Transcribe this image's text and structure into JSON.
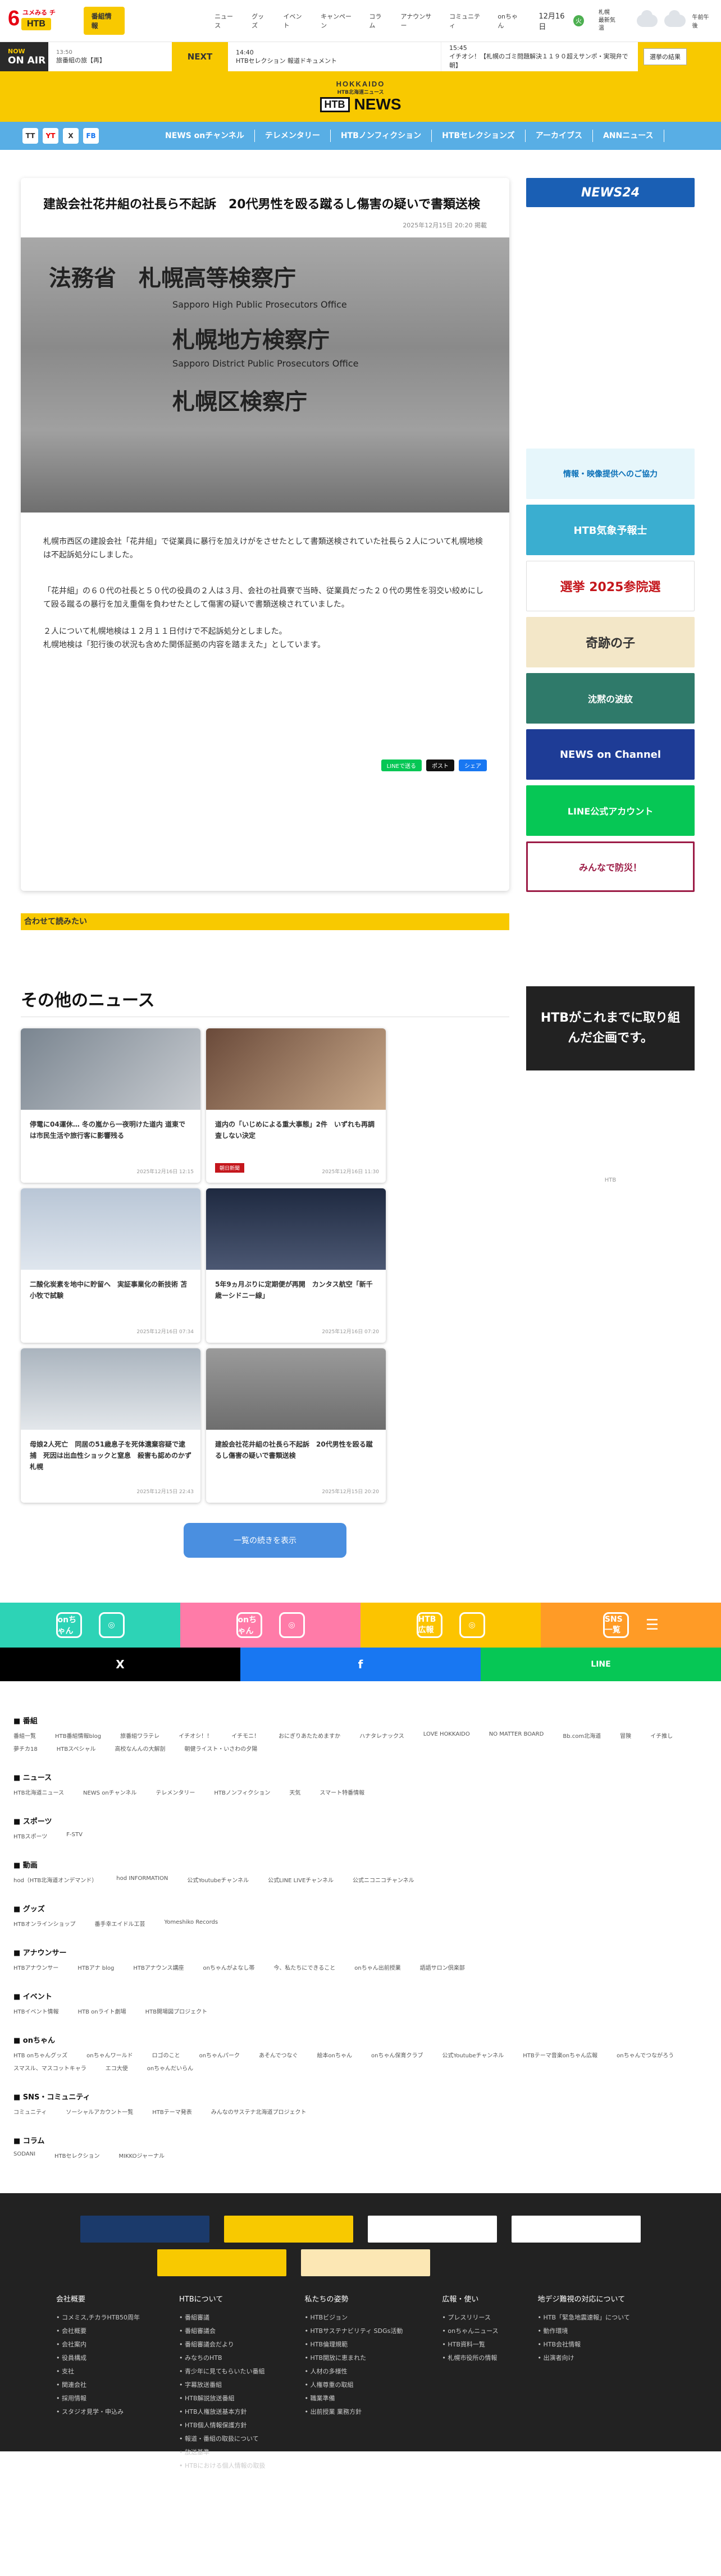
{
  "header": {
    "bangumi_label": "番組情報",
    "nav": [
      "ニュース",
      "グッズ",
      "イベント",
      "キャンペーン",
      "コラム",
      "アナウンサー",
      "コミュニティ",
      "onちゃん"
    ],
    "date": "12月16日",
    "date_badge": "火",
    "location_line1": "札幌",
    "location_line2": "最新気温",
    "weather_text": "午前午後"
  },
  "ticker": {
    "now_label": "NOW",
    "onair_label": "ON AIR",
    "now_time": "13:50",
    "now_title": "旅番組の旅【再】",
    "next_label": "NEXT",
    "next_time": "14:40",
    "next_title": "HTBセレクション 報道ドキュメント",
    "info_time": "15:45",
    "info_title": "イチオシ！【札幌のゴミ問題解決１１９０超えサンポ・実現弁で朝】",
    "vote_label": "選挙の結果"
  },
  "brand": {
    "line1": "HOKKAIDO",
    "line2": "HTB北海道ニュース",
    "htb": "HTB",
    "news": "NEWS"
  },
  "subnav": {
    "sns": [
      "TT",
      "YT",
      "X",
      "FB"
    ],
    "items": [
      "NEWS onチャンネル",
      "テレメンタリー",
      "HTBノンフィクション",
      "HTBセレクションズ",
      "アーカイブス",
      "ANNニュース"
    ]
  },
  "article": {
    "title": "建設会社花井組の社長ら不起訴　20代男性を殴る蹴るし傷害の疑いで書類送検",
    "date": "2025年12月15日 20:20 掲載",
    "photo_signs": [
      "法務省　札幌高等検察庁",
      "Sapporo High Public Prosecutors Office",
      "札幌地方検察庁",
      "Sapporo District Public Prosecutors Office",
      "札幌区検察庁"
    ],
    "paragraphs": [
      "札幌市西区の建設会社「花井組」で従業員に暴行を加えけがをさせたとして書類送検されていた社長ら２人について札幌地検は不起訴処分にしました。",
      "「花井組」の６０代の社長と５０代の役員の２人は３月、会社の社員寮で当時、従業員だった２０代の男性を羽交い絞めにして殴る蹴るの暴行を加え重傷を負わせたとして傷害の疑いで書類送検されていました。",
      "２人について札幌地検は１２月１１日付けで不起訴処分としました。\n札幌地検は「犯行後の状況も含めた関係証拠の内容を踏まえた」としています。"
    ],
    "share": [
      "LINEで送る",
      "ポスト",
      "シェア"
    ]
  },
  "related_label": "合わせて読みたい",
  "side": {
    "news24": "NEWS24",
    "banners": [
      "情報・映像提供へのご協力",
      "HTB気象予報士",
      "選挙 2025参院選",
      "奇跡の子",
      "沈黙の波紋",
      "NEWS on Channel",
      "LINE公式アカウント",
      "みんなで防災！"
    ],
    "promo": "HTBがこれまでに取り組んだ企画です。",
    "promo_caption": "HTB"
  },
  "other": {
    "heading": "その他のニュース",
    "items": [
      {
        "title": "停電に04運休… 冬の嵐から一夜明けた道内 道東では市民生活や旅行客に影響残る",
        "date": "2025年12月16日 12:15"
      },
      {
        "title": "道内の「いじめによる重大事態」2件　いずれも再調査しない決定",
        "date": "2025年12月16日 11:30",
        "tag": "朝日新聞"
      },
      {
        "title": "二酸化炭素を地中に貯留へ　実証事業化の新技術 苫小牧で試験",
        "date": "2025年12月16日 07:34"
      },
      {
        "title": "5年9ヵ月ぶりに定期便が再開　カンタス航空「新千歳ーシドニー線」",
        "date": "2025年12月16日 07:20"
      },
      {
        "title": "母娘2人死亡　同居の51歳息子を死体遺棄容疑で逮捕　死因は出血性ショックと窒息　殺害も認めのかず　札幌",
        "date": "2025年12月15日 22:43"
      },
      {
        "title": "建設会社花井組の社長ら不起訴　20代男性を殴る蹴るし傷害の疑いで書類送検",
        "date": "2025年12月15日 20:20"
      }
    ],
    "more_label": "一覧の続きを表示"
  },
  "colorbar": [
    "onちゃん",
    "onちゃん",
    "HTB広報",
    "SNS一覧"
  ],
  "sharebar": [
    "X",
    "f",
    "LINE"
  ],
  "links": [
    {
      "h": "番組",
      "items": [
        "番組一覧",
        "HTB番組情報blog",
        "旅番組ワラテレ",
        "イチオシ！！",
        "イチモニ！",
        "おにぎりあたためますか",
        "ハナタレナックス",
        "LOVE HOKKAIDO",
        "NO MATTER BOARD",
        "Bb.com北海道",
        "冒険",
        "イチ推し",
        "夢チカ18",
        "HTBスペシャル",
        "高校なんんの大解剖",
        "朝健ライスト・いさわの夕陽"
      ]
    },
    {
      "h": "ニュース",
      "items": [
        "HTB北海道ニュース",
        "NEWS onチャンネル",
        "テレメンタリー",
        "HTBノンフィクション",
        "天気",
        "スマート特番情報"
      ]
    },
    {
      "h": "スポーツ",
      "items": [
        "HTBスポーツ",
        "F-STV"
      ]
    },
    {
      "h": "動画",
      "items": [
        "hod（HTB北海道オンデマンド）",
        "hod INFORMATION",
        "公式Youtubeチャンネル",
        "公式LINE LIVEチャンネル",
        "公式ニコニコチャンネル"
      ]
    },
    {
      "h": "グッズ",
      "items": [
        "HTBオンラインショップ",
        "番手幸エイドル工芸",
        "Yomeshiko Records"
      ]
    },
    {
      "h": "アナウンサー",
      "items": [
        "HTBアナウンサー",
        "HTBアナ blog",
        "HTBアナウンス講座",
        "onちゃんがよなし帯",
        "今、私たちにできること",
        "onちゃん出前授業",
        "語語サロン倶楽部"
      ]
    },
    {
      "h": "イベント",
      "items": [
        "HTBイベント情報",
        "HTB onライト劇場",
        "HTB開場図プロジェクト"
      ]
    },
    {
      "h": "onちゃん",
      "items": [
        "HTB onちゃんグッズ",
        "onちゃんワールド",
        "ロゴのこと",
        "onちゃんパーク",
        "あそんでつなぐ",
        "絵本onちゃん",
        "onちゃん保育クラブ",
        "公式Youtubeチャンネル",
        "HTBテーマ音楽onちゃん広報",
        "onちゃんでつながろう",
        "スマスル、マスコットキャラ",
        "エコ大使",
        "onちゃんだいらん"
      ]
    },
    {
      "h": "SNS・コミュニティ",
      "items": [
        "コミュニティ",
        "ソーシャルアカウント一覧",
        "HTBテーマ発表",
        "みんなのサステナ北海道プロジェクト"
      ]
    },
    {
      "h": "コラム",
      "items": [
        "SODANI",
        "HTBセレクション",
        "MIKKOジャーナル"
      ]
    }
  ],
  "footer": {
    "cols": [
      {
        "h": "会社概要",
        "items": [
          "コメミス,チカラHTB50周年",
          "会社概要",
          "会社案内",
          "役員構成",
          "支社",
          "関連会社",
          "採用情報",
          "スタジオ見学・申込み"
        ]
      },
      {
        "h": "HTBについて",
        "items": [
          "番組審議",
          "番組審議会",
          "番組審議会だより",
          "みなちのHTB",
          "青少年に見てもらいたい番組",
          "字幕放送番組",
          "HTB解説放送番組",
          "HTB人権放送基本方針",
          "HTB個人情報保護方針",
          "報道・番組の取扱について",
          "放送基準",
          "HTBにおける個人情報の取扱"
        ]
      },
      {
        "h": "私たちの姿勢",
        "items": [
          "HTBビジョン",
          "HTBサステナビリティ SDGs活動",
          "HTB倫理規範",
          "HTB開放に恵まれた",
          "人材の多様性",
          "人権尊重の取組",
          "職業準備",
          "出前授業 業務方針"
        ]
      },
      {
        "h": "広報・使い",
        "items": [
          "プレスリリース",
          "onちゃんニュース",
          "HTB資料一覧",
          "札幌市役所の情報"
        ]
      },
      {
        "h": "地デジ難視の対応について",
        "items": [
          "HTB「緊急地震速報」について",
          "動作環境",
          "HTB会社情報",
          "出演者向け"
        ]
      }
    ]
  }
}
